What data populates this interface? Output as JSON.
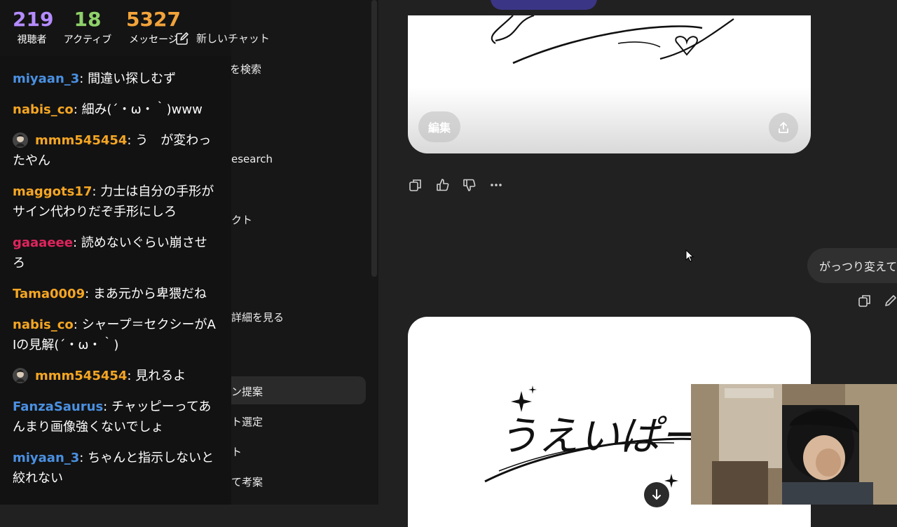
{
  "stream": {
    "stats": [
      {
        "value": "219",
        "label": "視聴者",
        "color": "#b58cff"
      },
      {
        "value": "18",
        "label": "アクティブ",
        "color": "#8fd16a"
      },
      {
        "value": "5327",
        "label": "メッセージ",
        "color": "#f2a33a"
      }
    ],
    "messages": [
      {
        "user": "miyaan_3",
        "color": "#4a90e2",
        "badge": false,
        "text": "間違い探しむず"
      },
      {
        "user": "nabis_co",
        "color": "#f5a623",
        "badge": false,
        "text": "細み(´・ω・｀)www"
      },
      {
        "user": "mmm545454",
        "color": "#f5a623",
        "badge": true,
        "text": "う　が変わったやん"
      },
      {
        "user": "maggots17",
        "color": "#f5a623",
        "badge": false,
        "text": "力士は自分の手形がサイン代わりだぞ手形にしろ"
      },
      {
        "user": "gaaaeee",
        "color": "#e0245e",
        "badge": false,
        "text": "読めないぐらい崩させろ"
      },
      {
        "user": "Tama0009",
        "color": "#f5a623",
        "badge": false,
        "text": "まあ元から卑猥だね"
      },
      {
        "user": "nabis_co",
        "color": "#f5a623",
        "badge": false,
        "text": "シャープ＝セクシーがAIの見解(´・ω・｀)"
      },
      {
        "user": "mmm545454",
        "color": "#f5a623",
        "badge": true,
        "text": "見れるよ"
      },
      {
        "user": "FanzaSaurus",
        "color": "#4a90e2",
        "badge": false,
        "text": "チャッピーってあんまり画像強くないでしょ"
      },
      {
        "user": "miyaan_3",
        "color": "#4a90e2",
        "badge": false,
        "text": "ちゃんと指示しないと絞れない"
      }
    ]
  },
  "sidebar": {
    "new_chat_label": "新しいチャット",
    "items": [
      {
        "label": "を検索"
      },
      {
        "label": "esearch"
      },
      {
        "label": "クト"
      },
      {
        "label": "詳細を見る"
      },
      {
        "label": "ン提案"
      },
      {
        "label": "ト選定"
      },
      {
        "label": "ト"
      },
      {
        "label": "て考案"
      }
    ]
  },
  "main": {
    "edit_label": "編集",
    "user_message": "がっつり変えて",
    "image_text_2": "うえいぱー高橋"
  }
}
